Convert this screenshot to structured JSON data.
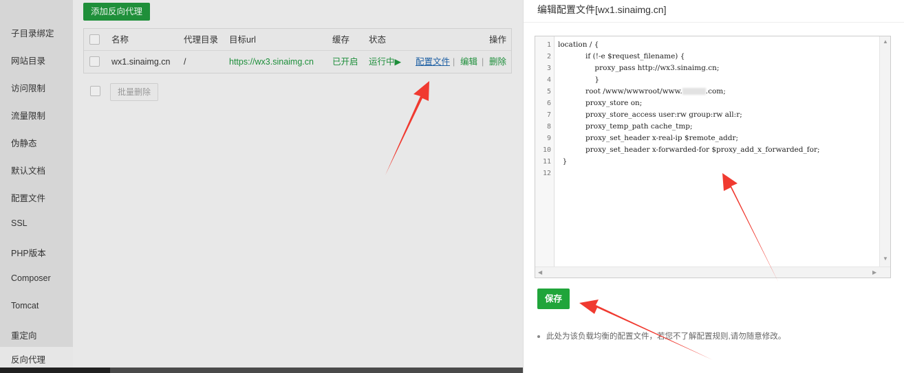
{
  "sidebar": {
    "items": [
      {
        "label": "子目录绑定"
      },
      {
        "label": "网站目录"
      },
      {
        "label": "访问限制"
      },
      {
        "label": "流量限制"
      },
      {
        "label": "伪静态"
      },
      {
        "label": "默认文档"
      },
      {
        "label": "配置文件"
      },
      {
        "label": "SSL"
      },
      {
        "label": "PHP版本"
      },
      {
        "label": "Composer"
      },
      {
        "label": "Tomcat"
      },
      {
        "label": "重定向"
      },
      {
        "label": "反向代理"
      }
    ],
    "active_index": 12
  },
  "main": {
    "add_button": "添加反向代理",
    "table": {
      "headers": [
        "名称",
        "代理目录",
        "目标url",
        "缓存",
        "状态",
        "操作"
      ],
      "rows": [
        {
          "name": "wx1.sinaimg.cn",
          "dir": "/",
          "url": "https://wx3.sinaimg.cn",
          "cache": "已开启",
          "status": "运行中▶",
          "actions": [
            "配置文件",
            "编辑",
            "删除"
          ]
        }
      ]
    },
    "batch_delete": "批量删除"
  },
  "modal": {
    "title": "编辑配置文件[wx1.sinaimg.cn]",
    "code_lines": [
      "location / {",
      "            if (!-e $request_filename) {",
      "                proxy_pass http://wx3.sinaimg.cn;",
      "                }",
      "            root /www/wwwroot/www.",
      "            proxy_store on;",
      "            proxy_store_access user:rw group:rw all:r;",
      "            proxy_temp_path cache_tmp;",
      "            proxy_set_header x-real-ip $remote_addr;",
      "            proxy_set_header x-forwarded-for $proxy_add_x_forwarded_for;",
      "  }",
      ""
    ],
    "root_line_suffix": ".com;",
    "line_numbers": [
      "1",
      "2",
      "3",
      "4",
      "5",
      "6",
      "7",
      "8",
      "9",
      "10",
      "11",
      "12"
    ],
    "save_button": "保存",
    "note": "此处为该负载均衡的配置文件，若您不了解配置规则,请勿随意修改。"
  },
  "colors": {
    "primary_green": "#20a53a",
    "arrow_red": "#f03a30"
  }
}
